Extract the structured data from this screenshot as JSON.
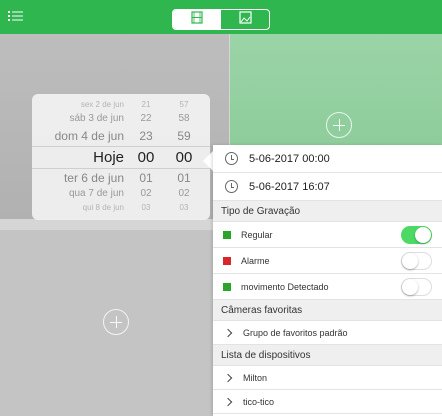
{
  "topbar": {
    "menu_icon": "list-icon",
    "tabs": [
      {
        "name": "single-view",
        "icon": "film-icon",
        "active": true
      },
      {
        "name": "grid-view",
        "icon": "image-icon",
        "active": false
      }
    ],
    "accent_color": "#2fb64f"
  },
  "picker": {
    "rows": [
      {
        "date": "sex 2 de jun",
        "hour": "21",
        "minute": "57"
      },
      {
        "date": "sáb 3 de jun",
        "hour": "22",
        "minute": "58"
      },
      {
        "date": "dom 4 de jun",
        "hour": "23",
        "minute": "59"
      },
      {
        "date": "Hoje",
        "hour": "00",
        "minute": "00"
      },
      {
        "date": "ter 6 de jun",
        "hour": "01",
        "minute": "01"
      },
      {
        "date": "qua 7 de jun",
        "hour": "02",
        "minute": "02"
      },
      {
        "date": "qui 8 de jun",
        "hour": "03",
        "minute": "03"
      }
    ]
  },
  "panel": {
    "start_time": "5-06-2017 00:00",
    "end_time": "5-06-2017 16:07",
    "recording_type_header": "Tipo de Gravação",
    "recording_types": [
      {
        "label": "Regular",
        "color": "#2aa52a",
        "enabled": true
      },
      {
        "label": "Alarme",
        "color": "#d9262b",
        "enabled": false
      },
      {
        "label": "movimento Detectado",
        "color": "#2aa52a",
        "enabled": false
      }
    ],
    "favorites_header": "Câmeras favoritas",
    "favorites": [
      {
        "label": "Grupo de favoritos padrão"
      }
    ],
    "devices_header": "Lista de dispositivos",
    "devices": [
      {
        "label": "Milton"
      },
      {
        "label": "tico-tico"
      }
    ]
  }
}
